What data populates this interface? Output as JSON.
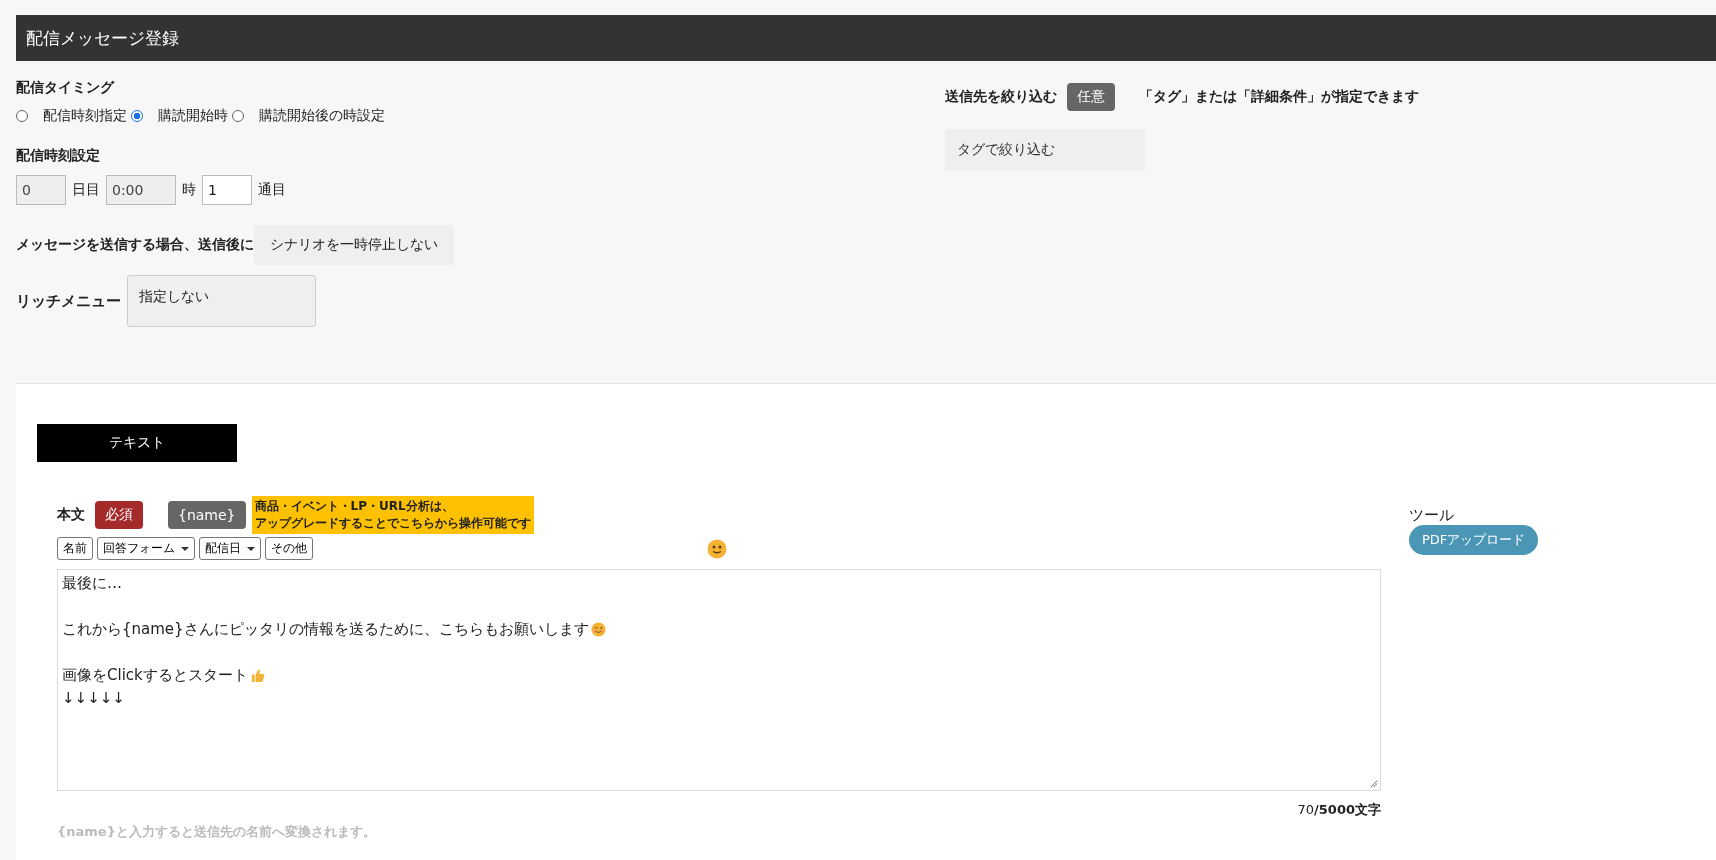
{
  "header": {
    "title": "配信メッセージ登録"
  },
  "timing": {
    "label": "配信タイミング",
    "options": [
      {
        "label": "配信時刻指定",
        "selected": false
      },
      {
        "label": "購読開始時",
        "selected": true
      },
      {
        "label": "購読開始後の時設定",
        "selected": false
      }
    ]
  },
  "time_setting": {
    "label": "配信時刻設定",
    "fields": [
      {
        "value": "0",
        "unit": "日目",
        "disabled": true
      },
      {
        "value": "0:00",
        "unit": "時",
        "disabled": true
      },
      {
        "value": "1",
        "unit": "通目",
        "disabled": false
      }
    ]
  },
  "after_send": {
    "label": "メッセージを送信する場合、送信後に",
    "value": "シナリオを一時停止しない"
  },
  "rich_menu": {
    "label": "リッチメニュー",
    "value": "指定しない"
  },
  "filter": {
    "label": "送信先を絞り込む",
    "badge": "任意",
    "note": "「タグ」または「詳細条件」が指定できます",
    "tag_button": "タグで絞り込む"
  },
  "tabs": [
    {
      "label": "テキスト",
      "selected": true
    }
  ],
  "body": {
    "label": "本文",
    "required_badge": "必須",
    "name_button": "{name}",
    "upgrade_note": [
      "商品・イベント・LP・URL分析は、",
      "アップグレードすることでこちらから操作可能です"
    ],
    "toolbar": [
      {
        "label": "名前",
        "dropdown": false
      },
      {
        "label": "回答フォーム",
        "dropdown": true
      },
      {
        "label": "配信日",
        "dropdown": true
      },
      {
        "label": "その他",
        "dropdown": false
      }
    ],
    "paragraphs": [
      [
        {
          "text": "最後に…",
          "kind": "plain"
        }
      ],
      [
        {
          "text": "これから{name}さんにピッタリの情報を送るために、こちらもお願いします",
          "kind": "wink"
        }
      ],
      [
        {
          "text": "画像をClickするとスタート",
          "kind": "thumbs"
        },
        {
          "text": "↓↓↓↓↓",
          "kind": "plain"
        }
      ]
    ],
    "count": "70",
    "limit": "/5000文字",
    "hint": "{name}と入力すると送信先の名前へ変換されます。"
  },
  "tools": {
    "label": "ツール",
    "buttons": [
      "PDFアップロード"
    ]
  }
}
